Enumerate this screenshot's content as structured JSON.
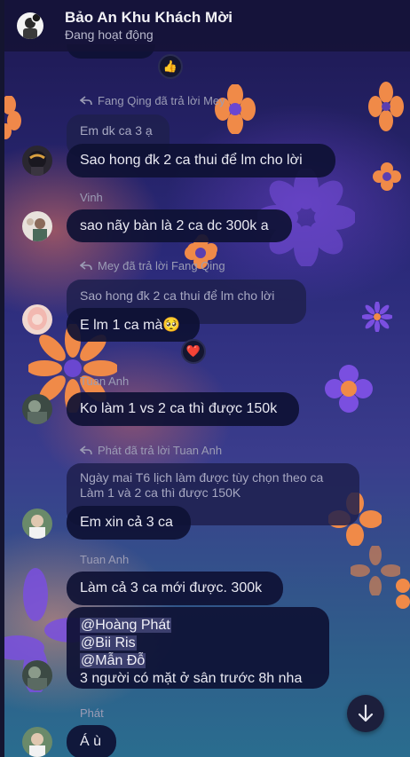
{
  "header": {
    "title": "Bảo An Khu Khách Mời",
    "status": "Đang hoạt động",
    "avatar": "group-avatar"
  },
  "messages": [
    {
      "type": "reaction",
      "emoji": "👍"
    },
    {
      "reply_label": "Fang Qing đã trả lời Mey",
      "quote": "Em dk ca 3 ạ",
      "text": "Sao hong đk 2 ca thui để lm cho lời"
    },
    {
      "sender": "Vinh",
      "text": "sao nãy bàn là 2 ca dc 300k a"
    },
    {
      "reply_label": "Mey đã trả lời Fang Qing",
      "quote": "Sao hong đk 2 ca thui để lm cho lời",
      "text": "E lm 1 ca mà🥺",
      "reaction": "❤️"
    },
    {
      "sender": "Tuan Anh",
      "text": "Ko làm 1 vs 2 ca thì được 150k"
    },
    {
      "reply_label": "Phát đã trả lời Tuan Anh",
      "quote_line1": "Ngày mai T6 lịch làm được tùy chọn theo ca",
      "quote_line2": "Làm 1 và 2 ca thì được 150K",
      "text": "Em xin cả 3 ca"
    },
    {
      "sender": "Tuan Anh",
      "text": "Làm cả 3 ca mới được. 300k",
      "mentions": [
        "@Hoàng Phát",
        "@Bii Ris",
        "@Mẫn Đỗ"
      ],
      "text2": "3 người có mặt ở sân trước 8h nha"
    },
    {
      "sender": "Phát",
      "text": "Á ù"
    }
  ],
  "scroll_button": "arrow-down-icon"
}
